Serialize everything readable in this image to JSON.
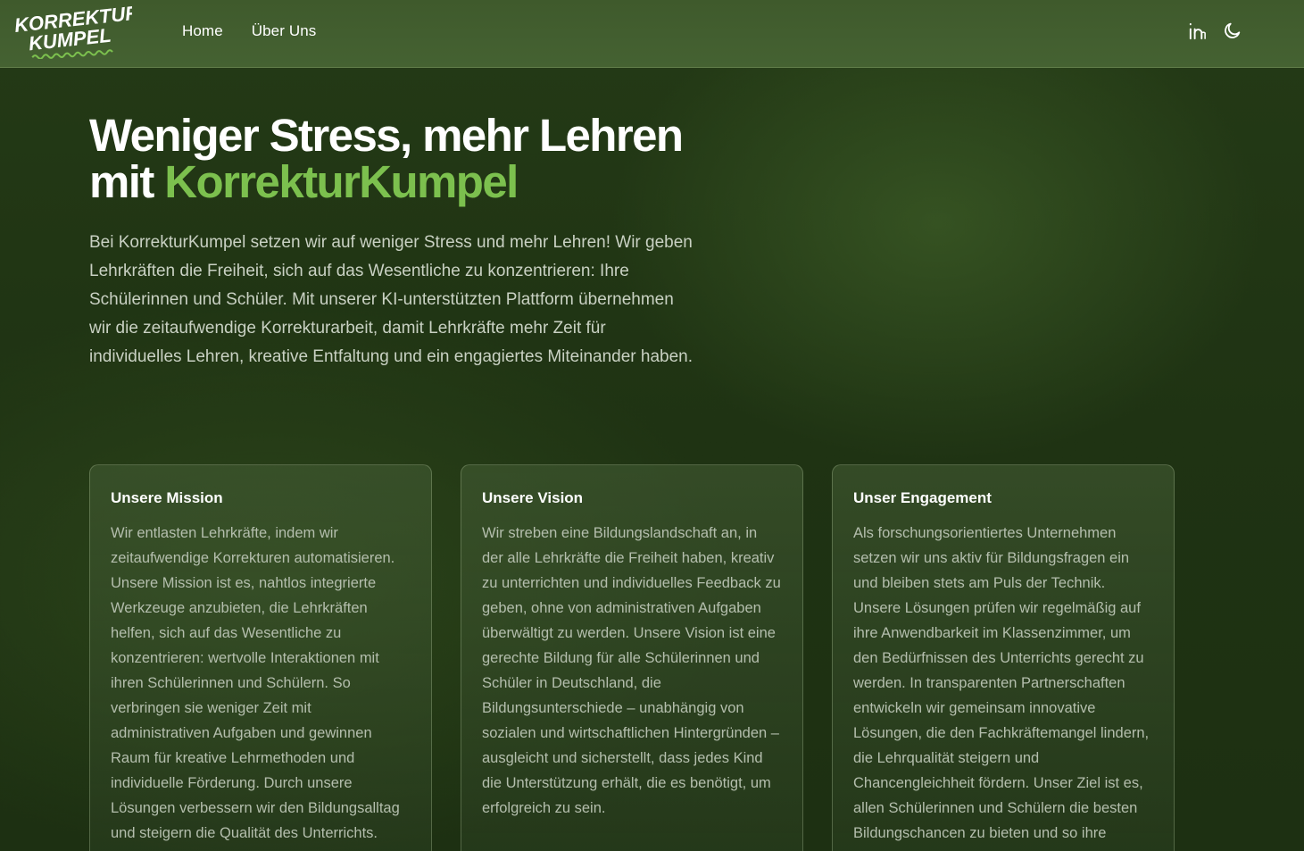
{
  "header": {
    "logo": {
      "line1": "KORREKTUR",
      "line2": "KUMPEL"
    },
    "nav": [
      {
        "label": "Home"
      },
      {
        "label": "Über Uns"
      }
    ],
    "icons": [
      "linkedin-icon",
      "moon-icon"
    ]
  },
  "hero": {
    "title_line1": "Weniger Stress, mehr Lehren",
    "title_prefix": "mit ",
    "title_brand": "KorrekturKumpel",
    "description": "Bei KorrekturKumpel setzen wir auf weniger Stress und mehr Lehren! Wir geben Lehrkräften die Freiheit, sich auf das Wesentliche zu konzentrieren: Ihre Schülerinnen und Schüler. Mit unserer KI-unterstützten Plattform übernehmen wir die zeitaufwendige Korrekturarbeit, damit Lehrkräfte mehr Zeit für individuelles Lehren, kreative Entfaltung und ein engagiertes Miteinander haben."
  },
  "cards": [
    {
      "title": "Unsere Mission",
      "text": "Wir entlasten Lehrkräfte, indem wir zeitaufwendige Korrekturen automatisieren. Unsere Mission ist es, nahtlos integrierte Werkzeuge anzubieten, die Lehrkräften helfen, sich auf das Wesentliche zu konzentrieren: wertvolle Interaktionen mit ihren Schülerinnen und Schülern. So verbringen sie weniger Zeit mit administrativen Aufgaben und gewinnen Raum für kreative Lehrmethoden und individuelle Förderung. Durch unsere Lösungen verbessern wir den Bildungsalltag und steigern die Qualität des Unterrichts."
    },
    {
      "title": "Unsere Vision",
      "text": "Wir streben eine Bildungslandschaft an, in der alle Lehrkräfte die Freiheit haben, kreativ zu unterrichten und individuelles Feedback zu geben, ohne von administrativen Aufgaben überwältigt zu werden. Unsere Vision ist eine gerechte Bildung für alle Schülerinnen und Schüler in Deutschland, die Bildungsunterschiede – unabhängig von sozialen und wirtschaftlichen Hintergründen – ausgleicht und sicherstellt, dass jedes Kind die Unterstützung erhält, die es benötigt, um erfolgreich zu sein."
    },
    {
      "title": "Unser Engagement",
      "text": "Als forschungsorientiertes Unternehmen setzen wir uns aktiv für Bildungsfragen ein und bleiben stets am Puls der Technik. Unsere Lösungen prüfen wir regelmäßig auf ihre Anwendbarkeit im Klassenzimmer, um den Bedürfnissen des Unterrichts gerecht zu werden. In transparenten Partnerschaften entwickeln wir gemeinsam innovative Lösungen, die den Fachkräftemangel lindern, die Lehrqualität steigern und Chancengleichheit fördern. Unser Ziel ist es, allen Schülerinnen und Schülern die besten Bildungschancen zu bieten und so ihre persönliche Zukunft zu sichern."
    }
  ],
  "colors": {
    "accent": "#7cc04e",
    "header_bg": "#435f30",
    "page_bg": "#1f3313"
  }
}
